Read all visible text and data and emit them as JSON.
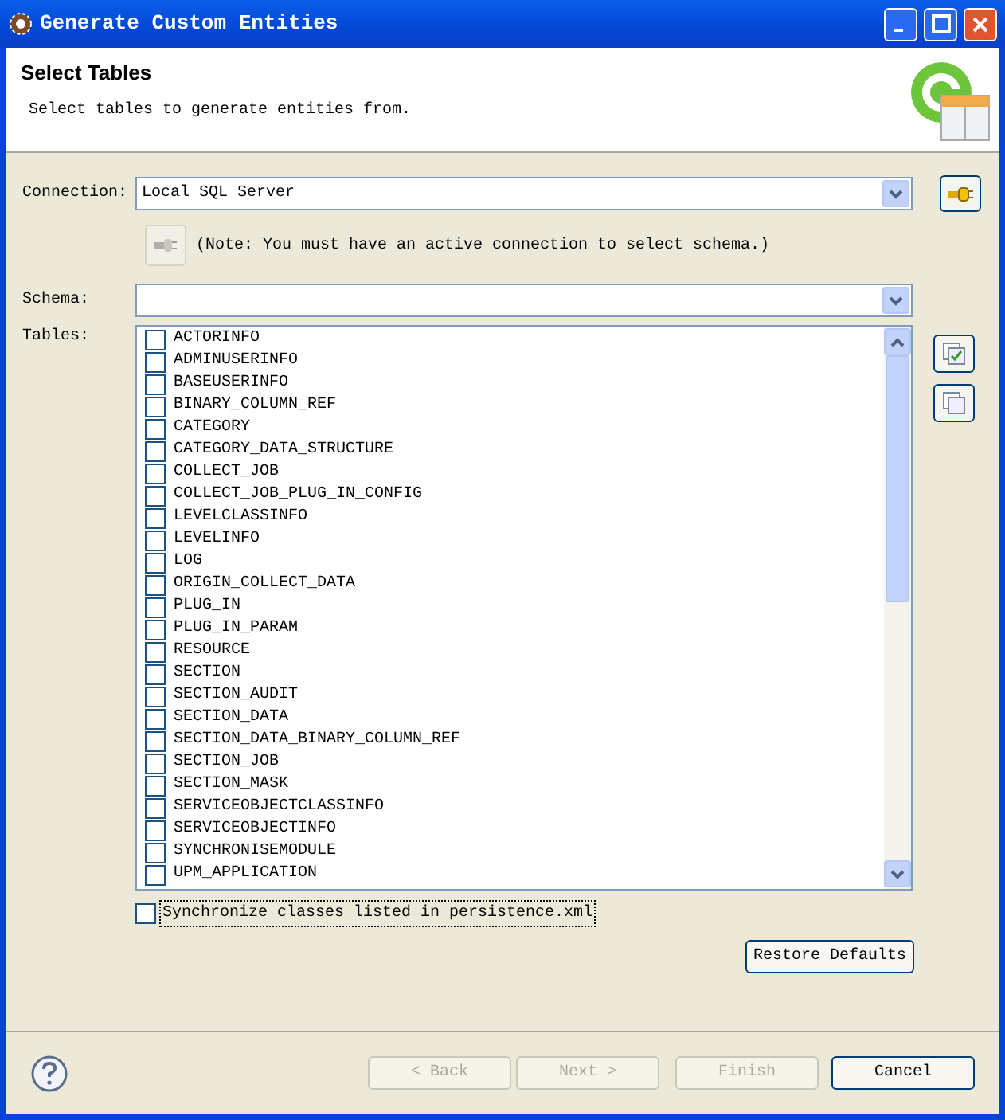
{
  "window": {
    "title": "Generate Custom Entities"
  },
  "header": {
    "title": "Select Tables",
    "description": "Select tables to generate entities from."
  },
  "connection": {
    "label": "Connection:",
    "value": "Local SQL Server"
  },
  "note": "(Note: You must have an active connection to select schema.)",
  "schema": {
    "label": "Schema:"
  },
  "tables": {
    "label": "Tables:",
    "items": [
      {
        "name": "ACTORINFO",
        "checked": false
      },
      {
        "name": "ADMINUSERINFO",
        "checked": false
      },
      {
        "name": "BASEUSERINFO",
        "checked": false
      },
      {
        "name": "BINARY_COLUMN_REF",
        "checked": false
      },
      {
        "name": "CATEGORY",
        "checked": false
      },
      {
        "name": "CATEGORY_DATA_STRUCTURE",
        "checked": false
      },
      {
        "name": "COLLECT_JOB",
        "checked": false
      },
      {
        "name": "COLLECT_JOB_PLUG_IN_CONFIG",
        "checked": false
      },
      {
        "name": "LEVELCLASSINFO",
        "checked": false
      },
      {
        "name": "LEVELINFO",
        "checked": false
      },
      {
        "name": "LOG",
        "checked": false
      },
      {
        "name": "ORIGIN_COLLECT_DATA",
        "checked": false
      },
      {
        "name": "PLUG_IN",
        "checked": false
      },
      {
        "name": "PLUG_IN_PARAM",
        "checked": false
      },
      {
        "name": "RESOURCE",
        "checked": false
      },
      {
        "name": "SECTION",
        "checked": false
      },
      {
        "name": "SECTION_AUDIT",
        "checked": false
      },
      {
        "name": "SECTION_DATA",
        "checked": false
      },
      {
        "name": "SECTION_DATA_BINARY_COLUMN_REF",
        "checked": false
      },
      {
        "name": "SECTION_JOB",
        "checked": false
      },
      {
        "name": "SECTION_MASK",
        "checked": false
      },
      {
        "name": "SERVICEOBJECTCLASSINFO",
        "checked": false
      },
      {
        "name": "SERVICEOBJECTINFO",
        "checked": false
      },
      {
        "name": "SYNCHRONISEMODULE",
        "checked": false
      },
      {
        "name": "UPM_APPLICATION",
        "checked": false
      }
    ]
  },
  "sync": {
    "label": "Synchronize classes listed in persistence.xml",
    "checked": false
  },
  "restore_button": "Restore Defaults",
  "footer_buttons": [
    {
      "label": "< Back",
      "disabled": true
    },
    {
      "label": "Next >",
      "disabled": true
    },
    {
      "label": "Finish",
      "disabled": true
    },
    {
      "label": "Cancel",
      "disabled": false
    }
  ]
}
